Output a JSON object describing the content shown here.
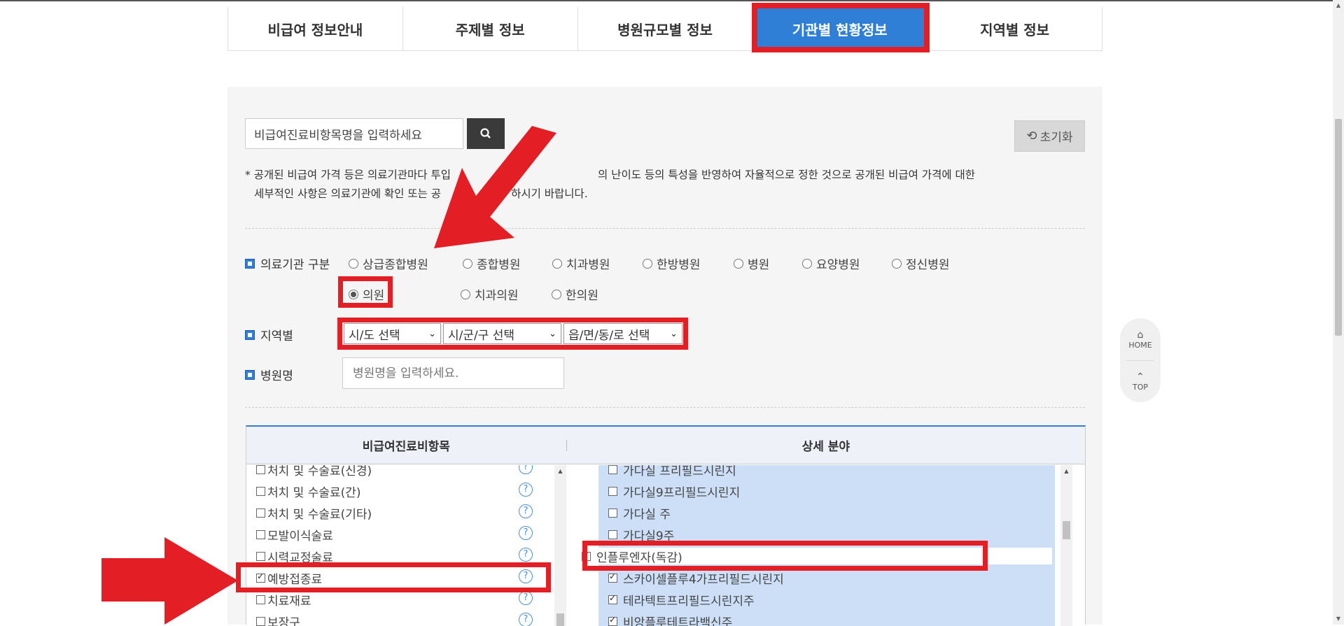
{
  "tabs": [
    {
      "label": "비급여 정보안내"
    },
    {
      "label": "주제별 정보"
    },
    {
      "label": "병원규모별 정보"
    },
    {
      "label": "기관별 현황정보"
    },
    {
      "label": "지역별 정보"
    }
  ],
  "active_tab_index": 3,
  "search": {
    "value": "비급여진료비항목명을 입력하세요"
  },
  "reset": {
    "label": "초기화"
  },
  "notice": {
    "line1": "* 공개된 비급여 가격 등은 의료기관마다 투입",
    "line1b": "의 난이도 등의 특성을 반영하여 자율적으로 정한 것으로 공개된 비급여 가격에 대한",
    "line2": "세부적인 사항은 의료기관에 확인 또는 공",
    "line2b": "하시기 바랍니다."
  },
  "institution": {
    "label": "의료기관 구분",
    "options": [
      "상급종합병원",
      "종합병원",
      "치과병원",
      "한방병원",
      "병원",
      "요양병원",
      "정신병원",
      "의원",
      "치과의원",
      "한의원"
    ],
    "selected": "의원"
  },
  "region": {
    "label": "지역별",
    "sido": "시/도 선택",
    "sigungu": "시/군/구 선택",
    "eup": "읍/면/동/로 선택"
  },
  "hospital": {
    "label": "병원명",
    "placeholder": "병원명을 입력하세요."
  },
  "table": {
    "col1_header": "비급여진료비항목",
    "col2_header": "상세 분야",
    "items": [
      {
        "label": "처치 및 수술료(신경)",
        "checked": false
      },
      {
        "label": "처치 및 수술료(간)",
        "checked": false
      },
      {
        "label": "처치 및 수술료(기타)",
        "checked": false
      },
      {
        "label": "모발이식술료",
        "checked": false
      },
      {
        "label": "시력교정술료",
        "checked": false
      },
      {
        "label": "예방접종료",
        "checked": true
      },
      {
        "label": "치료재료",
        "checked": false
      },
      {
        "label": "보장구",
        "checked": false
      }
    ],
    "details": [
      {
        "label": "가다실 프리필드시린지",
        "checked": false
      },
      {
        "label": "가다실9프리필드시린지",
        "checked": false
      },
      {
        "label": "가다실 주",
        "checked": false
      },
      {
        "label": "가다실9주",
        "checked": false
      },
      {
        "label": "인플루엔자(독감)",
        "checked": true
      },
      {
        "label": "스카이셀플루4가프리필드시린지",
        "checked": true
      },
      {
        "label": "테라텍트프리필드시린지주",
        "checked": true
      },
      {
        "label": "비앙플루테트라백신주",
        "checked": true
      }
    ]
  },
  "quick_nav": {
    "home": "HOME",
    "top": "TOP"
  },
  "colors": {
    "accent": "#2f7fd7",
    "highlight": "#e31e24",
    "detail_bg": "#cddff7"
  },
  "icons": [
    "search-icon",
    "refresh-icon",
    "help-icon",
    "home-icon",
    "top-arrow-icon"
  ]
}
